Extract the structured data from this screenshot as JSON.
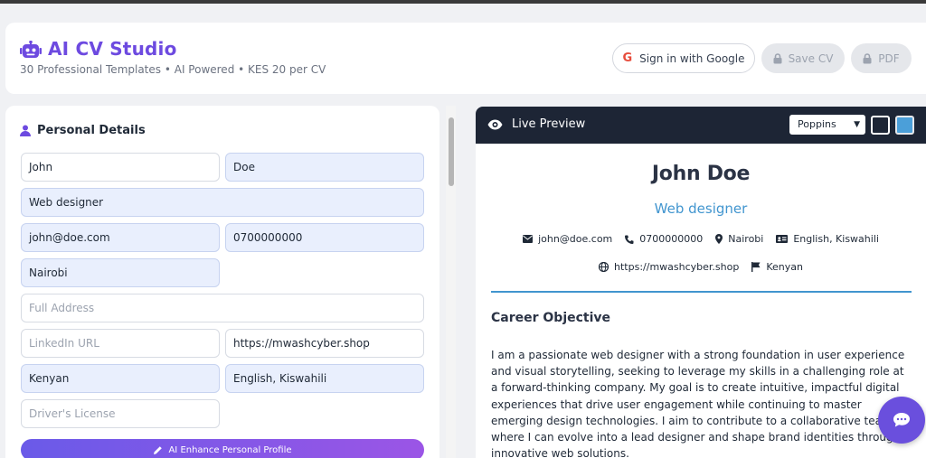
{
  "header": {
    "title": "AI CV Studio",
    "subtitle": "30 Professional Templates • AI Powered • KES 20 per CV",
    "google_btn": "Sign in with Google",
    "google_letter": "G",
    "save_btn": "Save CV",
    "pdf_btn": "PDF"
  },
  "form": {
    "section_title": "Personal Details",
    "first_name": "John",
    "last_name": "Doe",
    "job_title": "Web designer",
    "email": "john@doe.com",
    "phone": "0700000000",
    "city": "Nairobi",
    "address_placeholder": "Full Address",
    "linkedin_placeholder": "LinkedIn URL",
    "website": "https://mwashcyber.shop",
    "nationality": "Kenyan",
    "languages": "English, Kiswahili",
    "license_placeholder": "Driver's License",
    "ai_button": "AI Enhance Personal Profile"
  },
  "preview": {
    "title": "Live Preview",
    "font_option": "Poppins",
    "theme_colors": [
      "#1d2535",
      "#4b9fd9"
    ],
    "cv": {
      "name": "John Doe",
      "role": "Web designer",
      "email": "john@doe.com",
      "phone": "0700000000",
      "location": "Nairobi",
      "languages": "English, Kiswahili",
      "website": "https://mwashcyber.shop",
      "nationality": "Kenyan",
      "section_title": "Career Objective",
      "objective": "I am a passionate web designer with a strong foundation in user experience and visual storytelling, seeking to leverage my skills in a challenging role at a forward-thinking company. My goal is to create intuitive, impactful digital experiences that drive user engagement while continuing to master emerging design technologies. I aim to contribute to a collaborative team where I can evolve into a lead designer and shape brand identities through innovative web solutions."
    }
  },
  "colors": {
    "brand": "#6d4ae0",
    "accent": "#4195cf",
    "dark_bar": "#1d2535"
  }
}
